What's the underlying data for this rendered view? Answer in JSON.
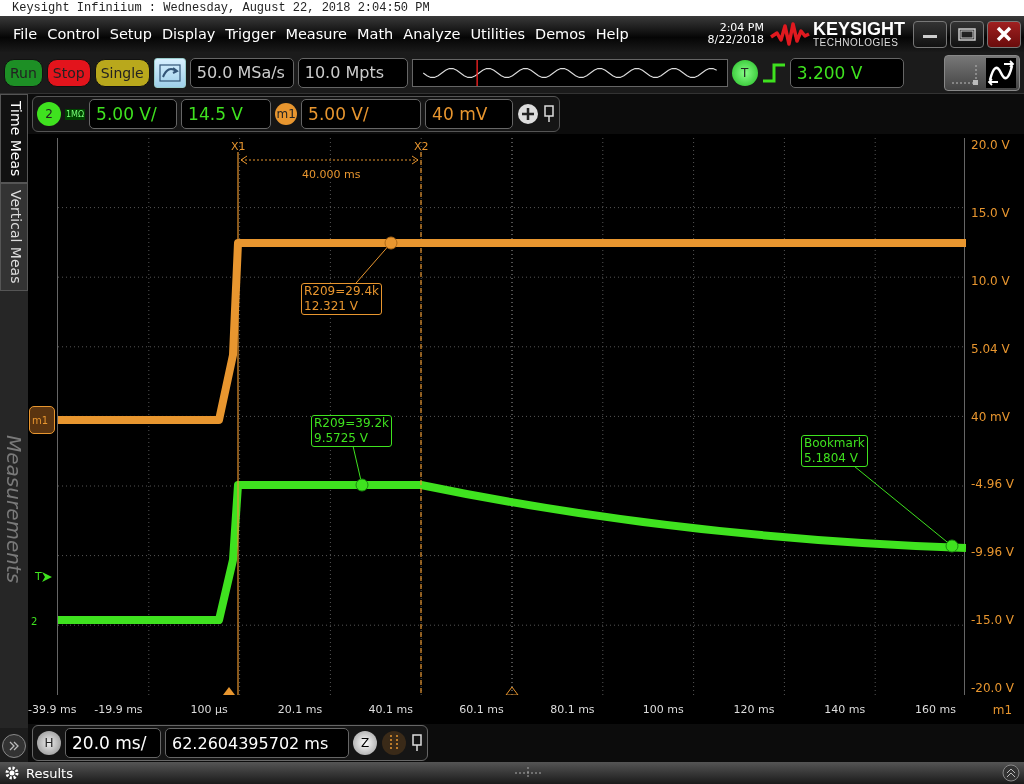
{
  "window": {
    "title": "Keysight Infiniium : Wednesday, August 22, 2018 2:04:50 PM"
  },
  "menu": [
    "File",
    "Control",
    "Setup",
    "Display",
    "Trigger",
    "Measure",
    "Math",
    "Analyze",
    "Utilities",
    "Demos",
    "Help"
  ],
  "clock": {
    "time": "2:04 PM",
    "date": "8/22/2018"
  },
  "logo": {
    "name": "KEYSIGHT",
    "subtitle": "TECHNOLOGIES"
  },
  "acquisition": {
    "buttons": [
      {
        "label": "Run",
        "color": "#1d8f25"
      },
      {
        "label": "Stop",
        "color": "#e3141c"
      },
      {
        "label": "Single",
        "color": "#b9a81c"
      }
    ],
    "sample_rate": "50.0 MSa/s",
    "memory_depth": "10.0 Mpts"
  },
  "trigger": {
    "badge": "T",
    "trigger_level": "3.200 V"
  },
  "side_tabs": [
    {
      "label": "Time Meas"
    },
    {
      "label": "Vertical Meas"
    }
  ],
  "side_panel_title": "Measurements",
  "channels": [
    {
      "badge": "2",
      "impedance": "1MΩ",
      "scale": "5.00 V/",
      "offset": "14.5 V",
      "color": "#3fe21f"
    },
    {
      "badge": "m1",
      "scale": "5.00 V/",
      "offset": "40 mV",
      "color": "#e8962f"
    }
  ],
  "plot": {
    "y_labels": [
      "20.0 V",
      "15.0 V",
      "10.0 V",
      "5.04 V",
      "40 mV",
      "-4.96 V",
      "-9.96 V",
      "-15.0 V",
      "-20.0 V"
    ],
    "x_labels": [
      "-39.9 ms",
      "-19.9 ms",
      "100 µs",
      "20.1 ms",
      "40.1 ms",
      "60.1 ms",
      "80.1 ms",
      "100 ms",
      "120 ms",
      "140 ms",
      "160 ms"
    ],
    "x_source": "m1",
    "cursors": [
      "X1",
      "X2"
    ],
    "cursor_delta": "40.000 ms",
    "markers": [
      {
        "lines": [
          "R209=29.4k",
          "12.321 V"
        ],
        "color": "#e8962f"
      },
      {
        "lines": [
          "R209=39.2k",
          "9.5725 V"
        ],
        "color": "#3fe21f"
      },
      {
        "lines": [
          "Bookmark",
          "5.1804 V"
        ],
        "color": "#3fe21f"
      }
    ],
    "ground_markers": [
      {
        "label": "m1",
        "color": "#e8962f"
      },
      {
        "label": "2",
        "color": "#3fe21f"
      }
    ],
    "trigger_marker": "T"
  },
  "horizontal": {
    "badge": "H",
    "scale": "20.0 ms/",
    "position": "62.2604395702 ms",
    "zoom_badge": "Z"
  },
  "results": {
    "label": "Results"
  }
}
